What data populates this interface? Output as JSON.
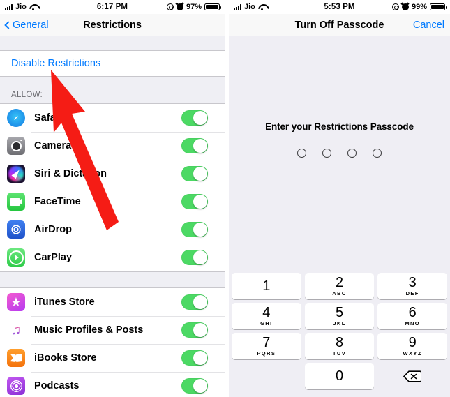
{
  "left_phone": {
    "status_bar": {
      "carrier": "Jio",
      "time": "6:17 PM",
      "battery": "97%",
      "wifi_icon": "wifi-icon",
      "signal_icon": "signal-bars-icon",
      "orientation_lock_icon": "rotation-lock-icon",
      "alarm_icon": "alarm-clock-icon",
      "battery_icon": "battery-icon"
    },
    "nav_bar": {
      "back_label": "General",
      "title": "Restrictions",
      "back_icon": "chevron-left-icon"
    },
    "disable_link": "Disable Restrictions",
    "group_header": "ALLOW:",
    "allow_rows": [
      {
        "label": "Safari",
        "icon": "safari-icon",
        "toggle": "on"
      },
      {
        "label": "Camera",
        "icon": "camera-icon",
        "toggle": "on"
      },
      {
        "label": "Siri & Dictation",
        "icon": "siri-icon",
        "toggle": "on"
      },
      {
        "label": "FaceTime",
        "icon": "facetime-icon",
        "toggle": "on"
      },
      {
        "label": "AirDrop",
        "icon": "airdrop-icon",
        "toggle": "on"
      },
      {
        "label": "CarPlay",
        "icon": "carplay-icon",
        "toggle": "on"
      }
    ],
    "store_rows": [
      {
        "label": "iTunes Store",
        "icon": "itunes-store-icon",
        "toggle": "on"
      },
      {
        "label": "Music Profiles & Posts",
        "icon": "music-icon",
        "toggle": "on"
      },
      {
        "label": "iBooks Store",
        "icon": "ibooks-icon",
        "toggle": "on"
      },
      {
        "label": "Podcasts",
        "icon": "podcasts-icon",
        "toggle": "on"
      }
    ],
    "annotation": {
      "type": "red-arrow",
      "color": "#f51c15",
      "points_to": "Disable Restrictions"
    }
  },
  "right_phone": {
    "status_bar": {
      "carrier": "Jio",
      "time": "5:53 PM",
      "battery": "99%",
      "wifi_icon": "wifi-icon",
      "signal_icon": "signal-bars-icon",
      "orientation_lock_icon": "rotation-lock-icon",
      "alarm_icon": "alarm-clock-icon",
      "battery_icon": "battery-icon"
    },
    "nav_bar": {
      "title": "Turn Off Passcode",
      "cancel_label": "Cancel"
    },
    "prompt": "Enter your Restrictions Passcode",
    "passcode_dots": 4,
    "keypad": [
      [
        {
          "num": "1",
          "sub": ""
        },
        {
          "num": "2",
          "sub": "ABC"
        },
        {
          "num": "3",
          "sub": "DEF"
        }
      ],
      [
        {
          "num": "4",
          "sub": "GHI"
        },
        {
          "num": "5",
          "sub": "JKL"
        },
        {
          "num": "6",
          "sub": "MNO"
        }
      ],
      [
        {
          "num": "7",
          "sub": "PQRS"
        },
        {
          "num": "8",
          "sub": "TUV"
        },
        {
          "num": "9",
          "sub": "WXYZ"
        }
      ]
    ],
    "zero_key": {
      "num": "0",
      "sub": ""
    },
    "delete_icon": "backspace-delete-icon"
  },
  "colors": {
    "accent_blue": "#007aff",
    "toggle_green": "#4cd964",
    "arrow_red": "#f51c15",
    "panel_bg": "#efeff4"
  }
}
